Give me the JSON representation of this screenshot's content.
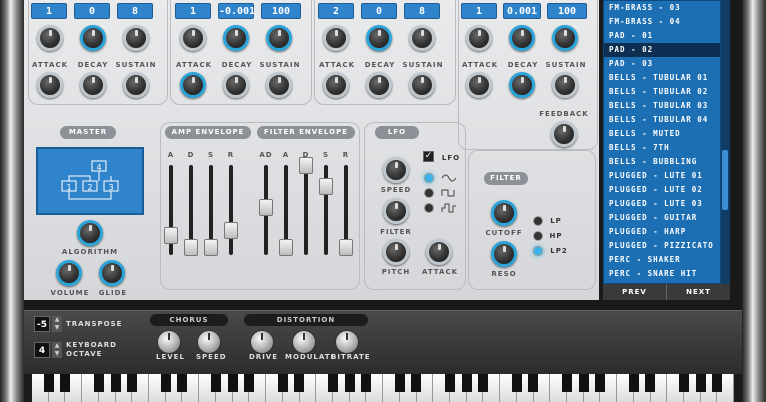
{
  "osc": [
    {
      "values": [
        "1",
        "0",
        "8"
      ],
      "knobs": [
        "ATTACK",
        "DECAY",
        "SUSTAIN"
      ]
    },
    {
      "values": [
        "1",
        "-0.001",
        "100"
      ],
      "knobs": [
        "ATTACK",
        "DECAY",
        "SUSTAIN"
      ]
    },
    {
      "values": [
        "2",
        "0",
        "8"
      ],
      "knobs": [
        "ATTACK",
        "DECAY",
        "SUSTAIN"
      ]
    },
    {
      "values": [
        "1",
        "0.001",
        "100"
      ],
      "knobs": [
        "ATTACK",
        "DECAY",
        "SUSTAIN"
      ],
      "extra": "FEEDBACK"
    }
  ],
  "sections": {
    "master": "MASTER",
    "amp_envelope": "AMP ENVELOPE",
    "filter_envelope": "FILTER ENVELOPE",
    "lfo": "LFO",
    "filter": "FILTER"
  },
  "master": {
    "algorithm": "ALGORITHM",
    "volume": "VOLUME",
    "glide": "GLIDE",
    "algo_boxes": [
      "1",
      "2",
      "3",
      "4"
    ]
  },
  "amp_env_labels": [
    "A",
    "D",
    "S",
    "R"
  ],
  "filter_env_labels": [
    "AD",
    "A",
    "D",
    "S",
    "R"
  ],
  "lfo": {
    "toggle": "LFO",
    "speed": "SPEED",
    "filter": "FILTER",
    "pitch": "PITCH",
    "attack": "ATTACK"
  },
  "filter": {
    "cutoff": "CUTOFF",
    "reso": "RESO",
    "modes": [
      "LP",
      "HP",
      "LP2"
    ]
  },
  "presets": {
    "items": [
      "FM-BRASS - 03",
      "FM-BRASS - 04",
      "PAD - 01",
      "PAD - 02",
      "PAD - 03",
      "BELLS - TUBULAR 01",
      "BELLS - TUBULAR 02",
      "BELLS - TUBULAR 03",
      "BELLS - TUBULAR 04",
      "BELLS - MUTED",
      "BELLS - 7TH",
      "BELLS - BUBBLING",
      "PLUGGED - LUTE 01",
      "PLUGGED - LUTE 02",
      "PLUGGED - LUTE 03",
      "PLUGGED - GUITAR",
      "PLUGGED - HARP",
      "PLUGGED - PIZZICATO",
      "PERC - SHAKER",
      "PERC - SNARE HIT"
    ],
    "selected_index": 3,
    "prev": "PREV",
    "next": "NEXT"
  },
  "bottom": {
    "transpose_value": "-5",
    "transpose_label": "TRANSPOSE",
    "octave_value": "4",
    "keyboard_label": "KEYBOARD",
    "octave_label": "OCTAVE",
    "chorus": "CHORUS",
    "level": "LEVEL",
    "speed": "SPEED",
    "distortion": "DISTORTION",
    "drive": "DRIVE",
    "modulate": "MODULATE",
    "bitrate": "BITRATE"
  },
  "colors": {
    "accent": "#2f84cc",
    "led": "#3ab4ea",
    "list_bg": "#1d6fb3"
  }
}
